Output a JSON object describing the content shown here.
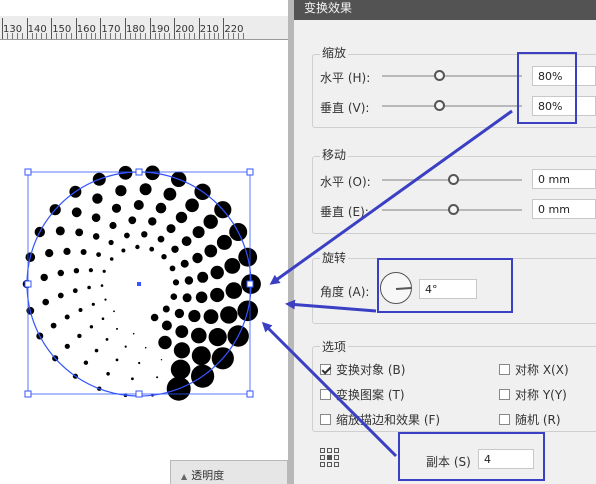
{
  "canvas": {
    "ruler_labels": [
      "130",
      "140",
      "150",
      "160",
      "170",
      "180",
      "190",
      "200",
      "210",
      "220"
    ],
    "bottom_tab": "透明度"
  },
  "dialog": {
    "title": "变换效果",
    "scale": {
      "title": "缩放",
      "horizontal_label": "水平 (H):",
      "horizontal_value": "80%",
      "vertical_label": "垂直 (V):",
      "vertical_value": "80%"
    },
    "move": {
      "title": "移动",
      "horizontal_label": "水平 (O):",
      "horizontal_value": "0 mm",
      "vertical_label": "垂直 (E):",
      "vertical_value": "0 mm"
    },
    "rotate": {
      "title": "旋转",
      "angle_label": "角度 (A):",
      "angle_value": "4°"
    },
    "options": {
      "title": "选项",
      "transform_objects": "变换对象 (B)",
      "transform_patterns": "变换图案 (T)",
      "scale_strokes": "缩放描边和效果 (F)",
      "reflect_x": "对称 X(X)",
      "reflect_y": "对称 Y(Y)",
      "random": "随机 (R)"
    },
    "copies": {
      "label": "副本 (S)",
      "value": "4"
    }
  },
  "colors": {
    "annotation_blue": "#3a3fc4",
    "selection_blue": "#3355ff",
    "titlebar": "#535353"
  },
  "icons": {
    "angle": "angle-dial-icon",
    "reference_point": "reference-point-icon"
  }
}
